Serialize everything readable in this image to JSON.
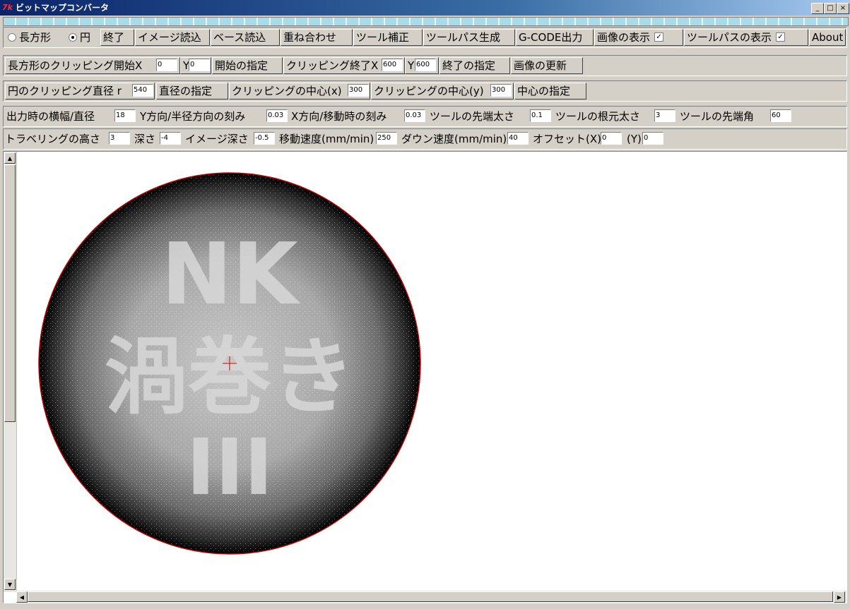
{
  "window": {
    "title": "ビットマップコンバータ",
    "icon_text": "7k",
    "controls": [
      "_",
      "□",
      "×"
    ]
  },
  "toolbar1": {
    "radio_rect": "長方形",
    "radio_circle": "円",
    "selected": "circle",
    "exit": "終了",
    "load_image": "イメージ読込",
    "load_base": "ベース読込",
    "overlay": "重ね合わせ",
    "tool_correct": "ツール補正",
    "toolpath_gen": "ツールパス生成",
    "gcode_out": "G-CODE出力",
    "show_image": "画像の表示",
    "show_image_checked": "☑",
    "show_toolpath": "ツールパスの表示",
    "show_toolpath_checked": "☑",
    "about": "About"
  },
  "toolbar2": {
    "rect_clip_start_x_label": "長方形のクリッピング開始X",
    "start_x": "0",
    "start_y_label": "Y",
    "start_y": "0",
    "set_start": "開始の指定",
    "clip_end_x_label": "クリッピング終了X",
    "end_x": "600",
    "end_y_label": "Y",
    "end_y": "600",
    "set_end": "終了の指定",
    "update_image": "画像の更新"
  },
  "toolbar3": {
    "circle_diameter_label": "円のクリッピング直径 r",
    "diameter": "540",
    "set_diameter": "直径の指定",
    "center_x_label": "クリッピングの中心(x)",
    "center_x": "300",
    "center_y_label": "クリッピングの中心(y)",
    "center_y": "300",
    "set_center": "中心の指定"
  },
  "toolbar4": {
    "output_width_label": "出力時の横幅/直径",
    "output_width": "18",
    "y_step_label": "Y方向/半径方向の刻み",
    "y_step": "0.03",
    "x_step_label": "X方向/移動時の刻み",
    "x_step": "0.03",
    "tip_width_label": "ツールの先端太さ",
    "tip_width": "0.1",
    "root_width_label": "ツールの根元太さ",
    "root_width": "3",
    "tip_angle_label": "ツールの先端角",
    "tip_angle": "60"
  },
  "toolbar5": {
    "travel_height_label": "トラベリングの高さ",
    "travel_height": "3",
    "depth_label": "深さ",
    "depth": "-4",
    "image_depth_label": "イメージ深さ",
    "image_depth": "-0.5",
    "move_speed_label": "移動速度(mm/min)",
    "move_speed": "250",
    "down_speed_label": "ダウン速度(mm/min)",
    "down_speed": "40",
    "offset_x_label": "オフセット(X)",
    "offset_x": "0",
    "offset_y_label": "(Y)",
    "offset_y": "0"
  },
  "canvas": {
    "line1": "NK",
    "line2": "渦巻き",
    "line3": "III",
    "outline_color": "#c00000",
    "crosshair_color": "#d00000"
  },
  "scroll": {
    "up": "▲",
    "down": "▼",
    "left": "◀",
    "right": "▶"
  }
}
